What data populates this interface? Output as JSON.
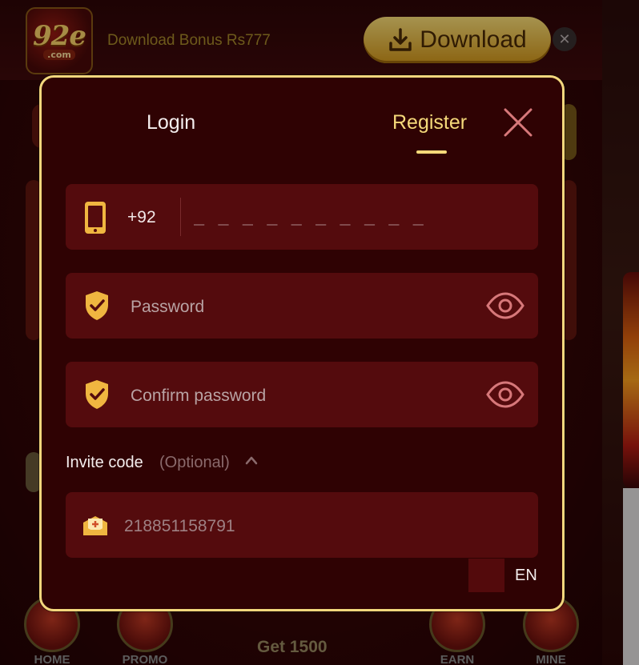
{
  "background": {
    "download_bar": {
      "logo_main": "92e",
      "logo_sub": ".com",
      "bonus_text": "Download Bonus Rs777",
      "download_label": "Download",
      "close_icon": "close-icon"
    },
    "bottom_nav": {
      "items": [
        {
          "label": "HOME",
          "icon": "home-icon"
        },
        {
          "label": "PROMO",
          "icon": "promo-icon"
        },
        {
          "label": "EARN",
          "icon": "gift-icon"
        },
        {
          "label": "MINE",
          "icon": "profile-icon"
        }
      ],
      "center_text": "Get 1500"
    }
  },
  "modal": {
    "tabs": [
      {
        "label": "Login",
        "active": false
      },
      {
        "label": "Register",
        "active": true
      }
    ],
    "close_icon": "close-icon",
    "phone": {
      "icon": "phone-icon",
      "country_code": "+92",
      "placeholder": "_ _ _ _ _ _ _ _ _ _"
    },
    "password": {
      "icon": "shield-check-icon",
      "placeholder": "Password",
      "toggle_icon": "eye-icon"
    },
    "confirm_password": {
      "icon": "shield-check-icon",
      "placeholder": "Confirm password",
      "toggle_icon": "eye-icon"
    },
    "invite": {
      "label": "Invite code",
      "optional": "(Optional)",
      "chevron_icon": "chevron-up-icon",
      "icon": "mail-icon",
      "value": "218851158791"
    },
    "language": "EN"
  },
  "colors": {
    "accent_gold": "#f5d97a",
    "modal_bg": "#2f0203",
    "field_bg": "#540b0d",
    "border": "#f3d77d"
  }
}
